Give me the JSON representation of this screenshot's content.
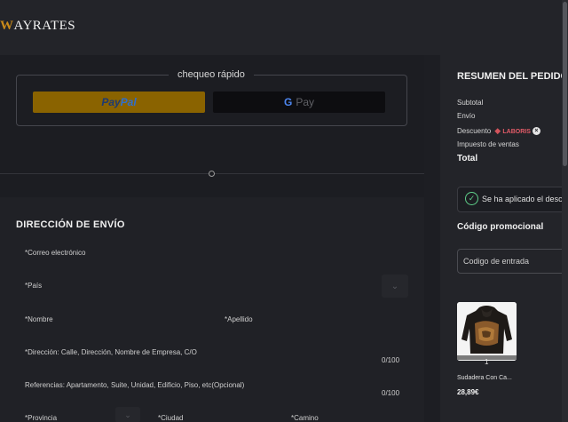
{
  "brand": {
    "logo_initial": "W",
    "logo_rest": "AYRATES"
  },
  "express_checkout": {
    "title": "chequeo rápido",
    "paypal_a": "Pay",
    "paypal_b": "Pal",
    "gpay_g": "G",
    "gpay_label": "Pay"
  },
  "shipping": {
    "title": "DIRECCIÓN DE ENVÍO",
    "email_label": "*Correo electrónico",
    "country_label": "*País",
    "first_name_label": "*Nombre",
    "last_name_label": "*Apellido",
    "address_label": "*Dirección: Calle, Dirección, Nombre de Empresa, C/O",
    "address_count": "0/100",
    "references_label": "Referencias: Apartamento, Suite, Unidad, Edificio, Piso, etc(Opcional)",
    "references_count": "0/100",
    "province_label": "*Provincia",
    "city_label": "*Ciudad",
    "road_label": "*Camino"
  },
  "summary": {
    "title": "RESUMEN DEL PEDIDO",
    "subtotal_label": "Subtotal",
    "shipping_label": "Envío",
    "discount_label": "Descuento",
    "discount_code": "LABORIS",
    "tax_label": "Impuesto de ventas",
    "total_label": "Total",
    "notice": "Se ha aplicado el descuento",
    "promo_title": "Código promocional",
    "promo_placeholder": "Codigo de entrada"
  },
  "product": {
    "name": "Sudadera Con Ca...",
    "quantity": "1",
    "price": "28,89€"
  },
  "colors": {
    "accent_gold": "#8a6300",
    "success_green": "#5fd08a",
    "discount_red": "#e35b67"
  }
}
